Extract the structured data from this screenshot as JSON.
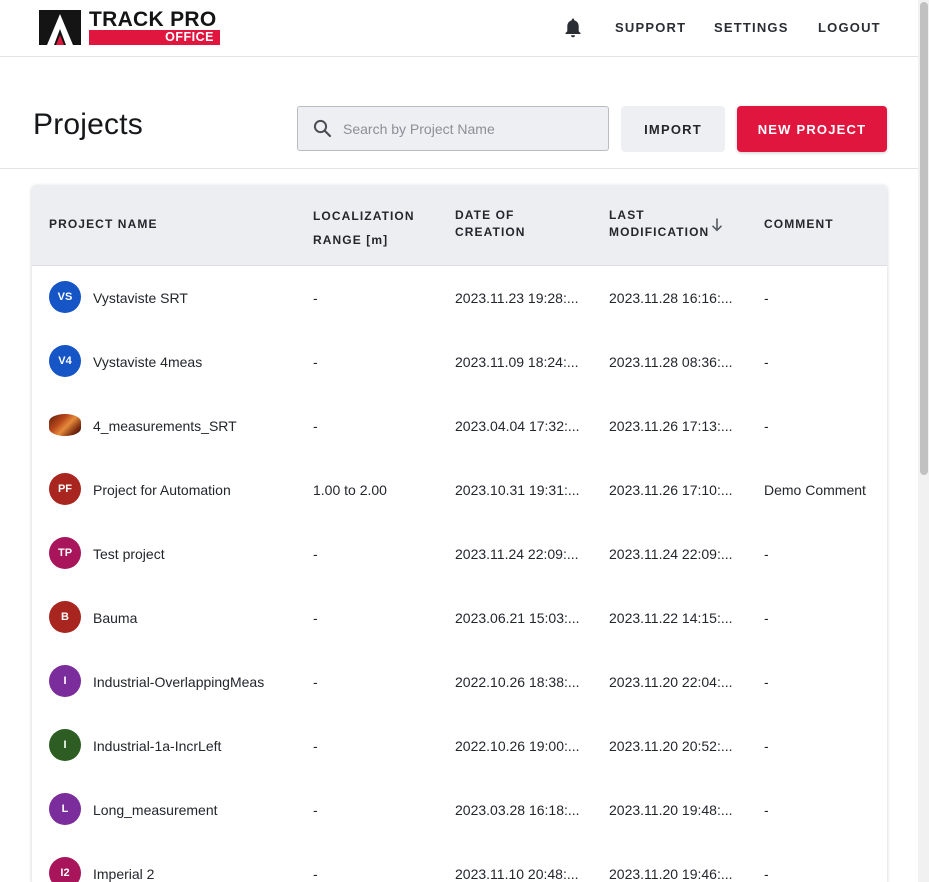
{
  "brand": {
    "name": "TRACK PRO",
    "sub": "OFFICE",
    "accent": "#e0163f"
  },
  "nav": {
    "support": "SUPPORT",
    "settings": "SETTINGS",
    "logout": "LOGOUT"
  },
  "page": {
    "title": "Projects"
  },
  "search": {
    "placeholder": "Search by Project Name",
    "value": ""
  },
  "buttons": {
    "import": "IMPORT",
    "new_project": "NEW PROJECT"
  },
  "table": {
    "headers": {
      "name": "PROJECT NAME",
      "range_1": "LOCALIZATION",
      "range_2": "RANGE [m]",
      "created_1": "DATE OF",
      "created_2": "CREATION",
      "mod_1": "LAST",
      "mod_2": "MODIFICATION",
      "comment": "COMMENT"
    },
    "sort": {
      "column": "last_modification",
      "direction": "descending",
      "icon": "arrow-down-icon"
    },
    "rows": [
      {
        "initials": "VS",
        "color": "#1655c6",
        "name": "Vystaviste SRT",
        "range": "-",
        "created": "2023.11.23 19:28:...",
        "modified": "2023.11.28 16:16:...",
        "comment": "-"
      },
      {
        "initials": "V4",
        "color": "#1655c6",
        "name": "Vystaviste 4meas",
        "range": "-",
        "created": "2023.11.09 18:24:...",
        "modified": "2023.11.28 08:36:...",
        "comment": "-"
      },
      {
        "initials": "",
        "color": "#b8471b",
        "name": "4_measurements_SRT",
        "range": "-",
        "created": "2023.04.04 17:32:...",
        "modified": "2023.11.26 17:13:...",
        "comment": "-"
      },
      {
        "initials": "PF",
        "color": "#a8261f",
        "name": "Project for Automation",
        "range": "1.00 to 2.00",
        "created": "2023.10.31 19:31:...",
        "modified": "2023.11.26 17:10:...",
        "comment": "Demo Comment"
      },
      {
        "initials": "TP",
        "color": "#a8155a",
        "name": "Test project",
        "range": "-",
        "created": "2023.11.24 22:09:...",
        "modified": "2023.11.24 22:09:...",
        "comment": "-"
      },
      {
        "initials": "B",
        "color": "#a8261f",
        "name": "Bauma",
        "range": "-",
        "created": "2023.06.21 15:03:...",
        "modified": "2023.11.22 14:15:...",
        "comment": "-"
      },
      {
        "initials": "I",
        "color": "#7b2d9c",
        "name": "Industrial-OverlappingMeas",
        "range": "-",
        "created": "2022.10.26 18:38:...",
        "modified": "2023.11.20 22:04:...",
        "comment": "-"
      },
      {
        "initials": "I",
        "color": "#2e5d23",
        "name": "Industrial-1a-IncrLeft",
        "range": "-",
        "created": "2022.10.26 19:00:...",
        "modified": "2023.11.20 20:52:...",
        "comment": "-"
      },
      {
        "initials": "L",
        "color": "#7b2d9c",
        "name": "Long_measurement",
        "range": "-",
        "created": "2023.03.28 16:18:...",
        "modified": "2023.11.20 19:48:...",
        "comment": "-"
      },
      {
        "initials": "I2",
        "color": "#a8155a",
        "name": "Imperial 2",
        "range": "-",
        "created": "2023.11.10 20:48:...",
        "modified": "2023.11.20 19:46:...",
        "comment": "-"
      }
    ]
  }
}
